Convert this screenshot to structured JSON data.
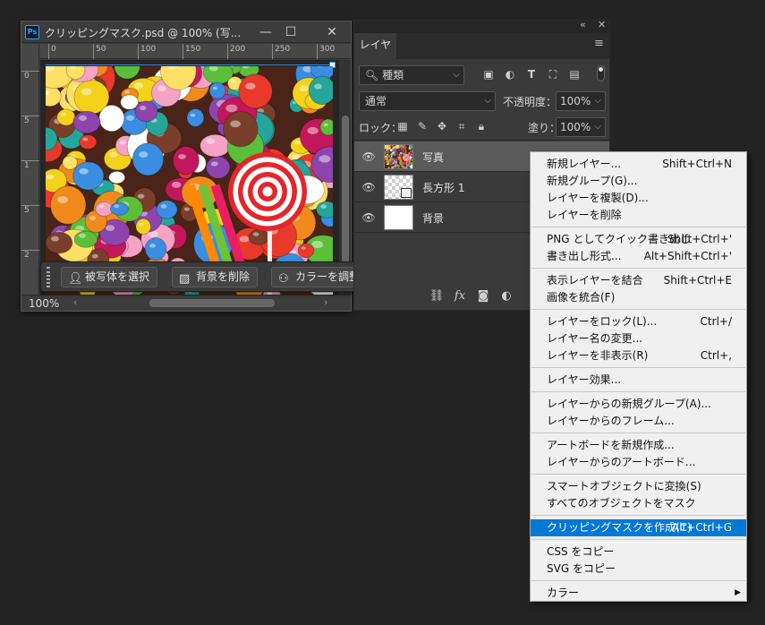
{
  "document": {
    "app_icon": "Ps",
    "title": "クリッピングマスク.psd @ 100% (写...",
    "ruler_h": [
      "0",
      "50",
      "100",
      "150",
      "200",
      "250",
      "300"
    ],
    "ruler_v": [
      "0",
      "5",
      "1",
      "5",
      "2"
    ],
    "zoom": "100%"
  },
  "taskbar": {
    "select_subject": "被写体を選択",
    "remove_bg": "背景を削除",
    "adjust_color": "カラーを調整",
    "more": "•••"
  },
  "layers_panel": {
    "tab": "レイヤー",
    "filter": "種類",
    "blend_mode": "通常",
    "opacity_label": "不透明度：",
    "opacity_value": "100%",
    "lock_label": "ロック：",
    "fill_label": "塗り：",
    "fill_value": "100%",
    "layers": [
      {
        "name": "写真"
      },
      {
        "name": "長方形 1"
      },
      {
        "name": "背景"
      }
    ],
    "footer_fx": "fx"
  },
  "context_menu": {
    "groups": [
      [
        {
          "label": "新規レイヤー...",
          "shortcut": "Shift+Ctrl+N"
        },
        {
          "label": "新規グループ(G)...",
          "shortcut": ""
        },
        {
          "label": "レイヤーを複製(D)...",
          "shortcut": ""
        },
        {
          "label": "レイヤーを削除",
          "shortcut": ""
        }
      ],
      [
        {
          "label": "PNG としてクイック書き出し",
          "shortcut": "Shift+Ctrl+'"
        },
        {
          "label": "書き出し形式...",
          "shortcut": "Alt+Shift+Ctrl+'"
        }
      ],
      [
        {
          "label": "表示レイヤーを結合",
          "shortcut": "Shift+Ctrl+E"
        },
        {
          "label": "画像を統合(F)",
          "shortcut": ""
        }
      ],
      [
        {
          "label": "レイヤーをロック(L)...",
          "shortcut": "Ctrl+/"
        },
        {
          "label": "レイヤー名の変更...",
          "shortcut": ""
        },
        {
          "label": "レイヤーを非表示(R)",
          "shortcut": "Ctrl+,"
        }
      ],
      [
        {
          "label": "レイヤー効果...",
          "shortcut": ""
        }
      ],
      [
        {
          "label": "レイヤーからの新規グループ(A)...",
          "shortcut": ""
        },
        {
          "label": "レイヤーからのフレーム...",
          "shortcut": ""
        }
      ],
      [
        {
          "label": "アートボードを新規作成...",
          "shortcut": ""
        },
        {
          "label": "レイヤーからのアートボード...",
          "shortcut": ""
        }
      ],
      [
        {
          "label": "スマートオブジェクトに変換(S)",
          "shortcut": ""
        },
        {
          "label": "すべてのオブジェクトをマスク",
          "shortcut": ""
        }
      ],
      [
        {
          "label": "クリッピングマスクを作成(C)",
          "shortcut": "Alt+Ctrl+G",
          "highlighted": true
        }
      ],
      [
        {
          "label": "CSS をコピー",
          "shortcut": ""
        },
        {
          "label": "SVG をコピー",
          "shortcut": ""
        }
      ],
      [
        {
          "label": "カラー",
          "shortcut": "",
          "submenu": true
        }
      ]
    ]
  },
  "colors": {
    "highlight": "#0078d7",
    "ps_blue": "#2fa3f7"
  }
}
